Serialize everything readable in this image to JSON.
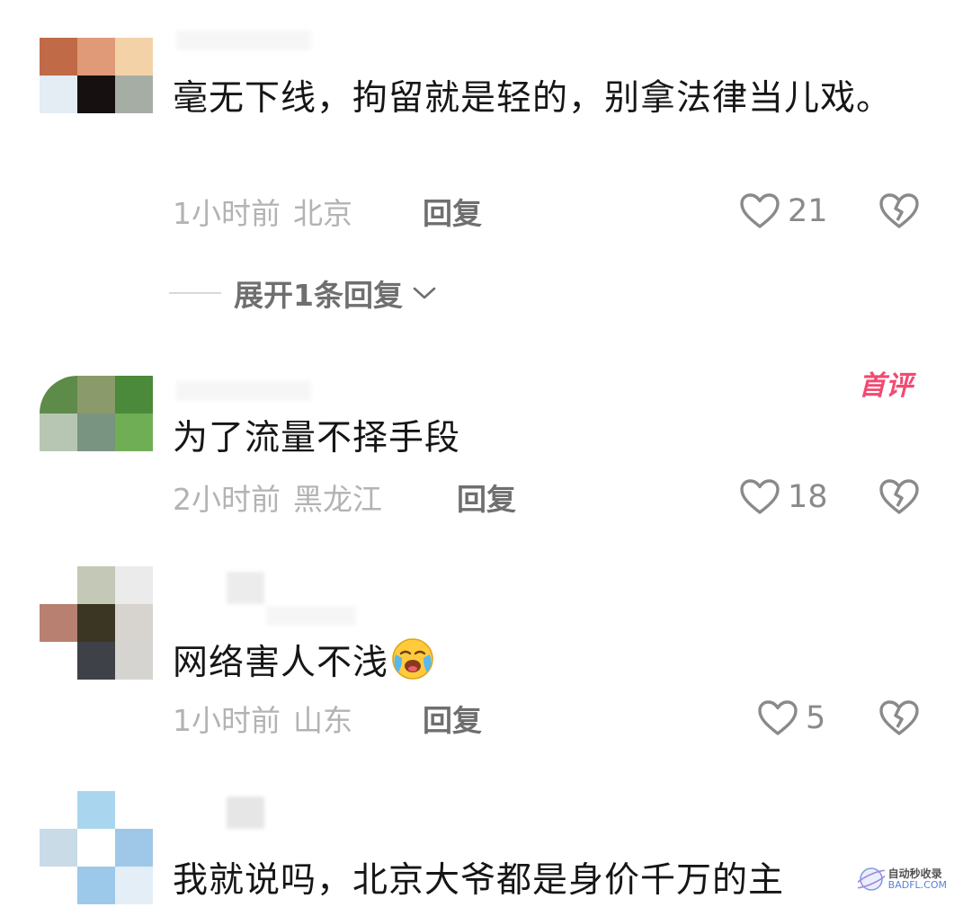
{
  "comments": [
    {
      "text": "毫无下线，拘留就是轻的，别拿法律当儿戏。",
      "time": "1小时前",
      "location": "北京",
      "reply_label": "回复",
      "likes": "21",
      "expand_label": "展开1条回复",
      "avatar_colors": [
        "#c06a48",
        "#e09a78",
        "#f3d2a8",
        "#e4ecf4",
        "#161010",
        "#a6ada5"
      ]
    },
    {
      "text": "为了流量不择手段",
      "time": "2小时前",
      "location": "黑龙江",
      "reply_label": "回复",
      "likes": "18",
      "badge": "首评",
      "avatar_colors": [
        "#5e8a4a",
        "#8a9a6a",
        "#4a8a3a",
        "#b7c6b2",
        "#7a9482",
        "#6fae55"
      ]
    },
    {
      "text": "网络害人不浅",
      "time": "1小时前",
      "location": "山东",
      "reply_label": "回复",
      "likes": "5",
      "avatar_colors": [
        "#ffffff",
        "#c3c9b6",
        "#ebebeb",
        "#b88070",
        "#3b3524",
        "#d7d4cf",
        "#ffffff",
        "#3e4147",
        "#d6d4d1"
      ]
    },
    {
      "text": "我就说吗，北京大爷都是身价千万的主",
      "avatar_colors": [
        "#ffffff",
        "#a9d6ee",
        "#ffffff",
        "#c8dbe6",
        "#ffffff",
        "#9fc8e8",
        "#ffffff",
        "#9cc9ea",
        "#e3eef6"
      ]
    }
  ],
  "watermark": {
    "title": "自动秒收录",
    "url": "BADFL.COM"
  },
  "colors": {
    "meta_gray": "#b3b3b3",
    "action_gray": "#6f6f6f",
    "badge_pink": "#f24a72"
  },
  "icons": [
    "heart-icon",
    "broken-heart-icon",
    "chevron-down-icon",
    "crying-emoji-icon"
  ]
}
